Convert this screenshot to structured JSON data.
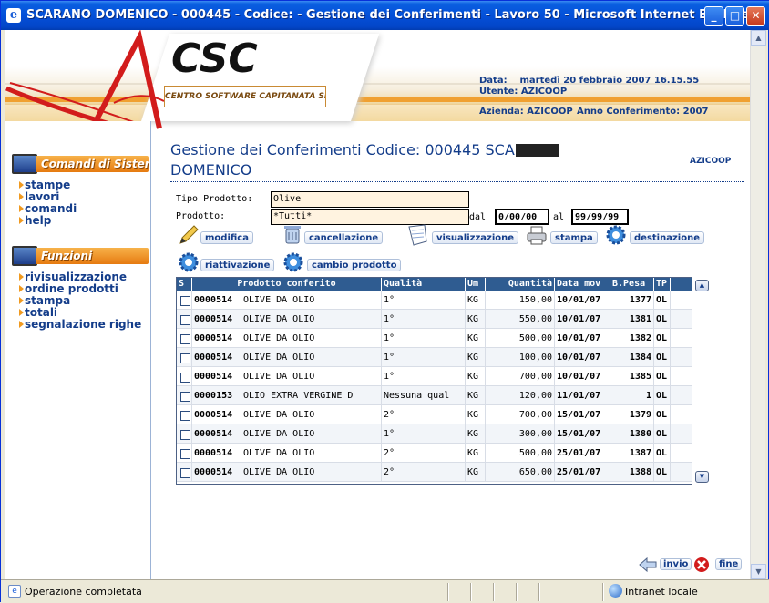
{
  "window": {
    "title": "SCARANO DOMENICO - 000445 - Codice: - Gestione dei Conferimenti - Lavoro 50 - Microsoft Internet Explorer",
    "min_icon": "minimize-icon",
    "max_icon": "maximize-icon",
    "close_icon": "close-icon"
  },
  "header": {
    "logo": "CSC",
    "logo_subtitle": "CENTRO SOFTWARE CAPITANATA SRL",
    "data_label": "Data:",
    "data_value": "martedì 20 febbraio 2007 16.15.55",
    "utente_label": "Utente:",
    "utente_value": "AZICOOP",
    "azienda_label": "Azienda:",
    "azienda_value": "AZICOOP",
    "anno_label": "Anno Conferimento:",
    "anno_value": "2007"
  },
  "sidebar": {
    "section1_title": "Comandi di Sistema",
    "section1_items": [
      "stampe",
      "lavori",
      "comandi",
      "help"
    ],
    "section2_title": "Funzioni",
    "section2_items": [
      "rivisualizzazione",
      "ordine prodotti",
      "stampa",
      "totali",
      "segnalazione righe"
    ]
  },
  "main": {
    "title_line1": "Gestione dei Conferimenti Codice: 000445 SCA",
    "title_line2": "DOMENICO",
    "user_tag": "AZICOOP",
    "tipo_label": "Tipo Prodotto:",
    "tipo_value": "Olive",
    "prodotto_label": "Prodotto:",
    "prodotto_value": "*Tutti*",
    "dal_label": "dal",
    "dal_value": "0/00/00",
    "al_label": "al",
    "al_value": "99/99/99",
    "buttons": {
      "modifica": "modifica",
      "cancellazione": "cancellazione",
      "visualizzazione": "visualizzazione",
      "stampa": "stampa",
      "destinazione": "destinazione",
      "riattivazione": "riattivazione",
      "cambio_prodotto": "cambio prodotto"
    }
  },
  "table": {
    "columns": [
      "S",
      "Prodotto conferito",
      "Qualità",
      "Um",
      "Quantità",
      "Data mov",
      "B.Pesa",
      "TP"
    ],
    "rows": [
      {
        "code": "0000514",
        "name": "OLIVE DA OLIO",
        "quality": "1°",
        "um": "KG",
        "qty": "150,00",
        "date": "10/01/07",
        "pesa": "1377",
        "tp": "OL"
      },
      {
        "code": "0000514",
        "name": "OLIVE DA OLIO",
        "quality": "1°",
        "um": "KG",
        "qty": "550,00",
        "date": "10/01/07",
        "pesa": "1381",
        "tp": "OL"
      },
      {
        "code": "0000514",
        "name": "OLIVE DA OLIO",
        "quality": "1°",
        "um": "KG",
        "qty": "500,00",
        "date": "10/01/07",
        "pesa": "1382",
        "tp": "OL"
      },
      {
        "code": "0000514",
        "name": "OLIVE DA OLIO",
        "quality": "1°",
        "um": "KG",
        "qty": "100,00",
        "date": "10/01/07",
        "pesa": "1384",
        "tp": "OL"
      },
      {
        "code": "0000514",
        "name": "OLIVE DA OLIO",
        "quality": "1°",
        "um": "KG",
        "qty": "700,00",
        "date": "10/01/07",
        "pesa": "1385",
        "tp": "OL"
      },
      {
        "code": "0000153",
        "name": "OLIO EXTRA VERGINE D",
        "quality": "Nessuna qual",
        "um": "KG",
        "qty": "120,00",
        "date": "11/01/07",
        "pesa": "1",
        "tp": "OL"
      },
      {
        "code": "0000514",
        "name": "OLIVE DA OLIO",
        "quality": "2°",
        "um": "KG",
        "qty": "700,00",
        "date": "15/01/07",
        "pesa": "1379",
        "tp": "OL"
      },
      {
        "code": "0000514",
        "name": "OLIVE DA OLIO",
        "quality": "1°",
        "um": "KG",
        "qty": "300,00",
        "date": "15/01/07",
        "pesa": "1380",
        "tp": "OL"
      },
      {
        "code": "0000514",
        "name": "OLIVE DA OLIO",
        "quality": "2°",
        "um": "KG",
        "qty": "500,00",
        "date": "25/01/07",
        "pesa": "1387",
        "tp": "OL"
      },
      {
        "code": "0000514",
        "name": "OLIVE DA OLIO",
        "quality": "2°",
        "um": "KG",
        "qty": "650,00",
        "date": "25/01/07",
        "pesa": "1388",
        "tp": "OL"
      }
    ]
  },
  "footer": {
    "invio": "invio",
    "fine": "fine"
  },
  "status": {
    "text": "Operazione completata",
    "zone": "Intranet locale"
  },
  "colors": {
    "accent_blue": "#143D8A",
    "table_header": "#2F5C91",
    "orange": "#F09A20"
  }
}
